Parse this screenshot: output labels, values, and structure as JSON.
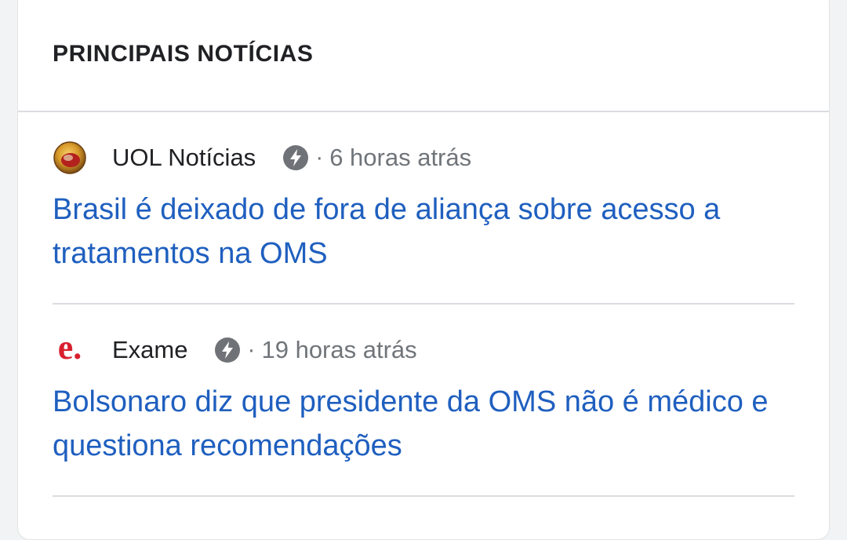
{
  "section": {
    "title": "PRINCIPAIS NOTÍCIAS"
  },
  "stories": [
    {
      "source": "UOL Notícias",
      "separator": "·",
      "time": "6 horas atrás",
      "headline": "Brasil é deixado de fora de aliança sobre acesso a tratamentos na OMS",
      "logo_icon": "uol-logo-icon"
    },
    {
      "source": "Exame",
      "separator": "·",
      "time": "19 horas atrás",
      "headline": "Bolsonaro diz que presidente da OMS não é médico e questiona recomendações",
      "logo_icon": "exame-logo-icon",
      "logo_letter": "e."
    }
  ],
  "colors": {
    "headline": "#1f5fbf",
    "meta": "#70757a",
    "title": "#202124",
    "exame_red": "#d8202f"
  }
}
